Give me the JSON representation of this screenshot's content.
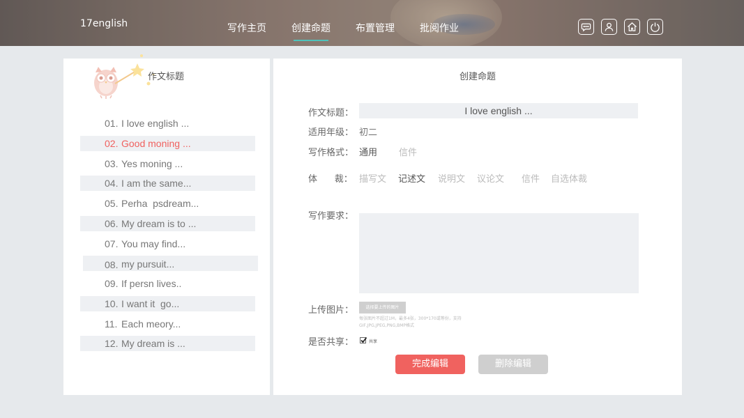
{
  "header": {
    "logo": "17english",
    "nav": [
      {
        "label": "写作主页",
        "active": false
      },
      {
        "label": "创建命题",
        "active": true
      },
      {
        "label": "布置管理",
        "active": false
      },
      {
        "label": "批阅作业",
        "active": false
      }
    ],
    "icons": [
      "chat-icon",
      "user-icon",
      "home-icon",
      "power-icon"
    ],
    "accent": "#4dc3bb"
  },
  "left_panel": {
    "title": "作文标题",
    "items": [
      {
        "num": "01.",
        "text": "I love english ...",
        "selected": false,
        "shaded": false
      },
      {
        "num": "02.",
        "text": "Good moning ...",
        "selected": true,
        "shaded": true
      },
      {
        "num": "03.",
        "text": "Yes moning ...",
        "selected": false,
        "shaded": false
      },
      {
        "num": "04.",
        "text": "I am the same...",
        "selected": false,
        "shaded": true
      },
      {
        "num": "05.",
        "text": "Perha  psdream...",
        "selected": false,
        "shaded": false
      },
      {
        "num": "06.",
        "text": "My dream is to ...",
        "selected": false,
        "shaded": true
      },
      {
        "num": "07.",
        "text": "You may find...",
        "selected": false,
        "shaded": false
      },
      {
        "num": "08.",
        "text": "my pursuit...",
        "selected": false,
        "shaded": true
      },
      {
        "num": "09.",
        "text": "If persn lives..",
        "selected": false,
        "shaded": false
      },
      {
        "num": "10.",
        "text": "I want it  go...",
        "selected": false,
        "shaded": true
      },
      {
        "num": "11.",
        "text": "Each meory...",
        "selected": false,
        "shaded": false
      },
      {
        "num": "12.",
        "text": "My dream is ...",
        "selected": false,
        "shaded": true
      }
    ],
    "selected_color": "#f0615f"
  },
  "form": {
    "title": "创建命题",
    "essay_title_label": "作文标题：",
    "essay_title_value": "I love english ...",
    "grade_label": "适用年级：",
    "grade_value": "初二",
    "format_label": "写作格式：",
    "format_options": [
      {
        "label": "通用",
        "active": true
      },
      {
        "label": "信件",
        "active": false
      }
    ],
    "genre_label": "体      裁：",
    "genre_options": [
      {
        "label": "描写文",
        "active": false
      },
      {
        "label": "记述文",
        "active": true
      },
      {
        "label": "说明文",
        "active": false
      },
      {
        "label": "议论文",
        "active": false
      },
      {
        "label": "信件",
        "active": false
      },
      {
        "label": "自选体裁",
        "active": false
      }
    ],
    "requirement_label": "写作要求：",
    "requirement_value": "",
    "upload_label": "上传图片：",
    "upload_button": "选择要上传的图片",
    "upload_hint": "每张图片不超过1M，最多4张，300*170或等份，支持GIF,JPG,JPEG,PNG,BMP格式",
    "share_label": "是否共享：",
    "share_checked": true,
    "share_text": "共享",
    "done_button": "完成编辑",
    "delete_button": "删除编辑",
    "done_color": "#f0625f"
  }
}
